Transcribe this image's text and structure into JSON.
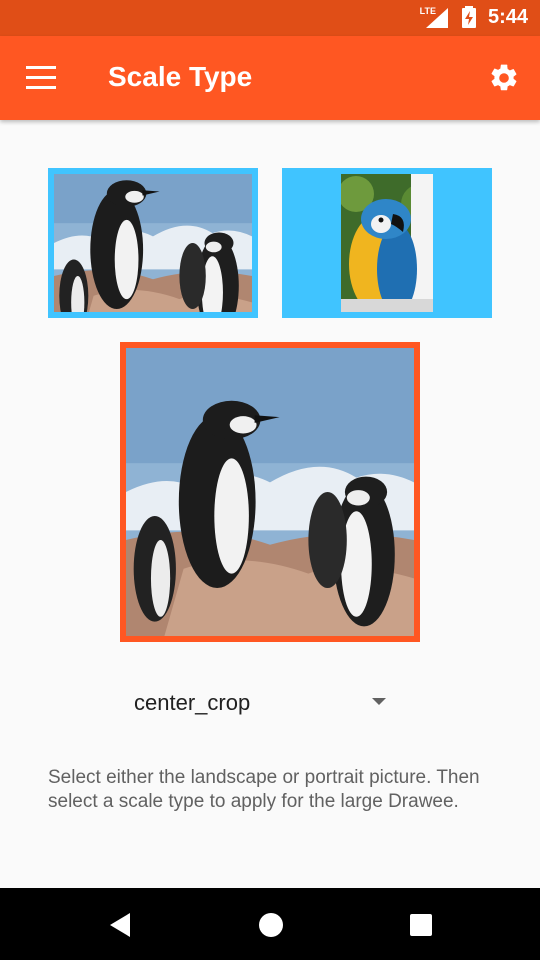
{
  "status_bar": {
    "network": "LTE",
    "time": "5:44"
  },
  "app_bar": {
    "title": "Scale Type",
    "menu_icon": "hamburger-menu-icon",
    "settings_icon": "gear-icon"
  },
  "images": {
    "landscape_thumb": "penguins-landscape",
    "portrait_thumb": "parrot-portrait",
    "large_drawee": "penguins-landscape",
    "selected_border_color": "#40c4ff",
    "large_border_color": "#ff5722"
  },
  "scale_type": {
    "selected": "center_crop"
  },
  "help_text": "Select either the landscape or portrait picture. Then select a scale type to apply for the large Drawee.",
  "nav_bar": {
    "back_icon": "back-icon",
    "home_icon": "home-icon",
    "recents_icon": "recents-icon"
  },
  "colors": {
    "primary": "#ff5722",
    "primary_dark": "#e04e17",
    "accent": "#40c4ff"
  }
}
